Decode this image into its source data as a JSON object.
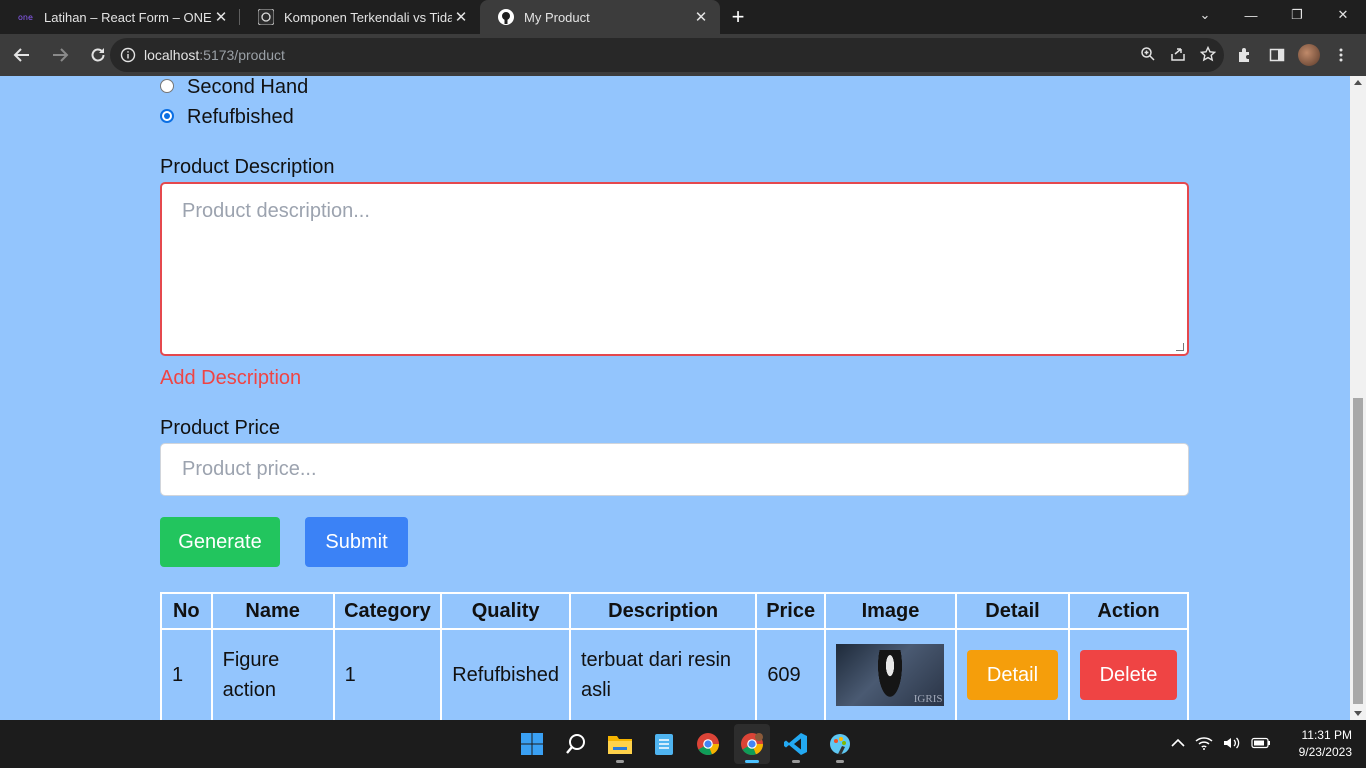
{
  "browser": {
    "tabs": [
      {
        "title": "Latihan – React Form – ONE by A",
        "favicon": "one-logo-icon",
        "active": false
      },
      {
        "title": "Komponen Terkendali vs Tidak Te",
        "favicon": "chatgpt-icon",
        "active": false
      },
      {
        "title": "My Product",
        "favicon": "github-icon",
        "active": true
      }
    ],
    "url_host": "localhost",
    "url_path": ":5173/product"
  },
  "form": {
    "radio_options": [
      {
        "label": "Second Hand",
        "checked": false
      },
      {
        "label": "Refufbished",
        "checked": true
      }
    ],
    "description_label": "Product Description",
    "description_placeholder": "Product description...",
    "description_error": "Add Description",
    "price_label": "Product Price",
    "price_placeholder": "Product price...",
    "generate_label": "Generate",
    "submit_label": "Submit"
  },
  "table": {
    "headers": [
      "No",
      "Name",
      "Category",
      "Quality",
      "Description",
      "Price",
      "Image",
      "Detail",
      "Action"
    ],
    "rows": [
      {
        "no": "1",
        "name": "Figure action",
        "category": "1",
        "quality": "Refufbished",
        "description": "terbuat dari resin asli",
        "price": "609",
        "image_text": "IGRIS",
        "detail_label": "Detail",
        "action_label": "Delete"
      }
    ]
  },
  "taskbar": {
    "time": "11:31 PM",
    "date": "9/23/2023"
  },
  "colors": {
    "page_bg": "#93c5fd",
    "generate": "#22c55e",
    "submit": "#3b82f6",
    "detail": "#f59e0b",
    "delete": "#ef4444",
    "error": "#ef4444"
  }
}
